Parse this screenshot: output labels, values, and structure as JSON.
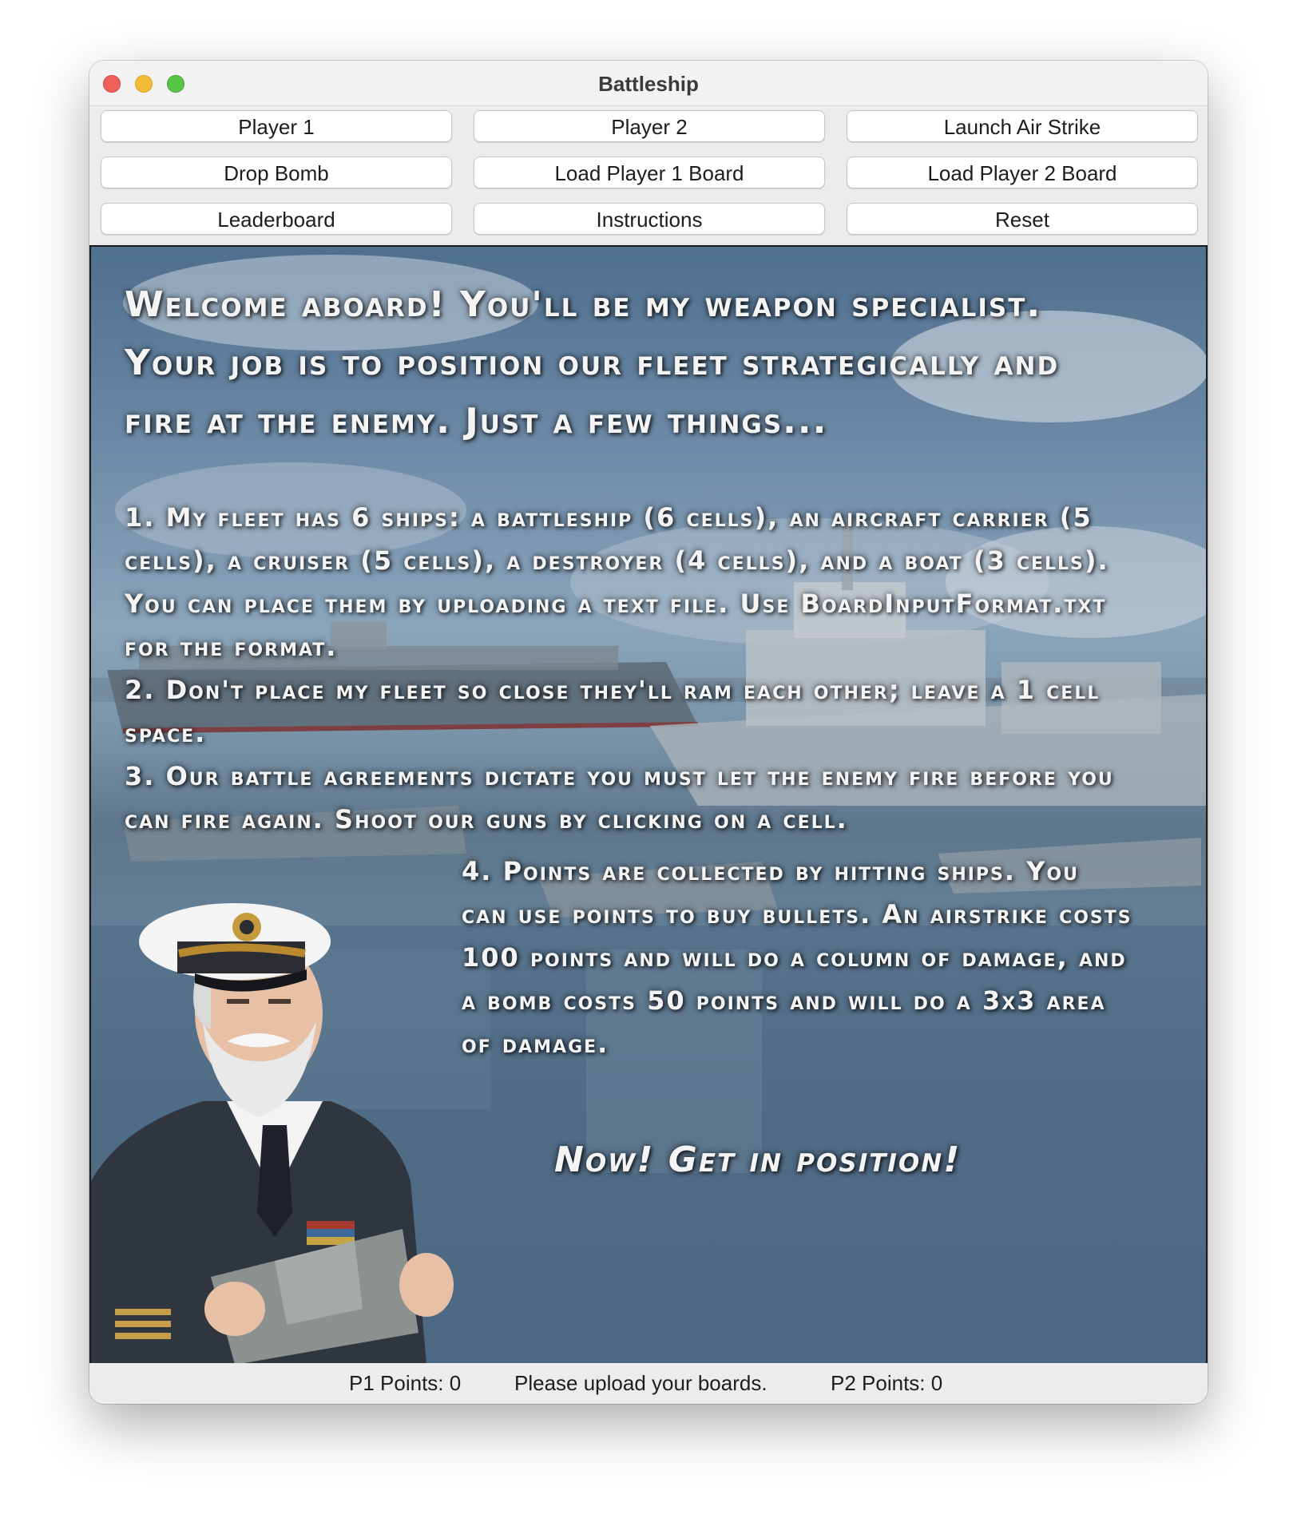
{
  "window": {
    "title": "Battleship"
  },
  "toolbar": {
    "player1": "Player 1",
    "player2": "Player 2",
    "air_strike": "Launch Air Strike",
    "drop_bomb": "Drop Bomb",
    "load_p1": "Load Player 1 Board",
    "load_p2": "Load Player 2 Board",
    "leaderboard": "Leaderboard",
    "instructions": "Instructions",
    "reset": "Reset"
  },
  "instructions": {
    "intro": "Welcome aboard! You'll be my weapon specialist. Your job is to position our fleet strategically and fire at the enemy. Just a few things...",
    "rule1": "1. My fleet has 6 ships: a battleship (6 cells), an aircraft carrier (5 cells), a cruiser (5 cells), a destroyer (4 cells), and a boat (3 cells). You can place them by uploading a text file. Use BoardInputFormat.txt for the format.",
    "rule2": "2. Don't place my fleet so close they'll ram each other; leave a 1 cell space.",
    "rule3": "3. Our battle agreements dictate you must let the enemy fire before you can fire again. Shoot our guns by clicking on a cell.",
    "rule4": "4. Points are collected by hitting ships. You can use points to buy bullets. An airstrike costs 100 points and will do a column of damage, and a bomb costs 50 points and will do a 3x3 area of damage.",
    "call_to_action": "Now! Get in position!"
  },
  "status": {
    "p1_points": "P1 Points: 0",
    "message": "Please upload your boards.",
    "p2_points": "P2 Points: 0"
  }
}
